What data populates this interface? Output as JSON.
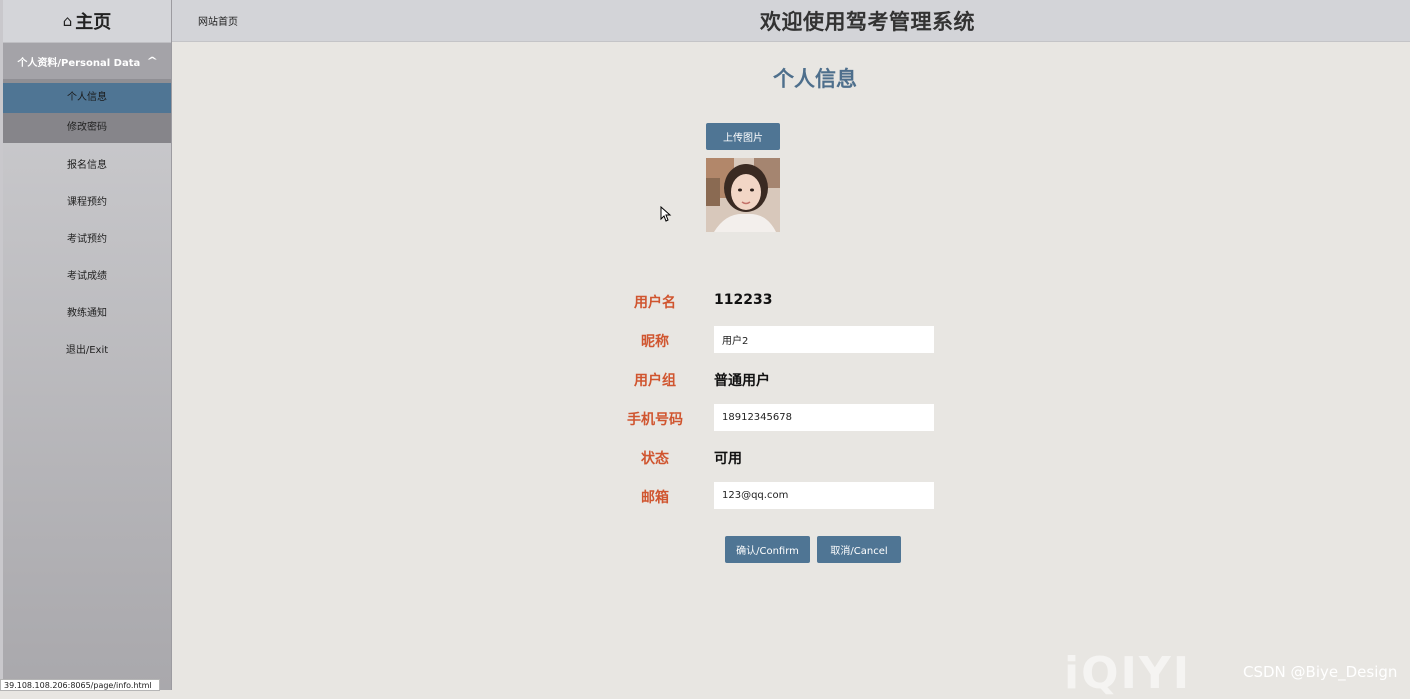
{
  "sidebar": {
    "home_label": "主页",
    "group_label": "个人资料/Personal Data",
    "sub_items": [
      {
        "label": "个人信息"
      },
      {
        "label": "修改密码"
      }
    ],
    "items": [
      {
        "label": "报名信息"
      },
      {
        "label": "课程预约"
      },
      {
        "label": "考试预约"
      },
      {
        "label": "考试成绩"
      },
      {
        "label": "教练通知"
      },
      {
        "label": "退出/Exit"
      }
    ]
  },
  "header": {
    "breadcrumb": "网站首页",
    "site_title": "欢迎使用驾考管理系统"
  },
  "main": {
    "title": "个人信息",
    "upload_label": "上传图片",
    "fields": {
      "username": {
        "label": "用户名",
        "value": "112233"
      },
      "nickname": {
        "label": "昵称",
        "value": "用户2"
      },
      "group": {
        "label": "用户组",
        "value": "普通用户"
      },
      "phone": {
        "label": "手机号码",
        "value": "18912345678"
      },
      "status": {
        "label": "状态",
        "value": "可用"
      },
      "email": {
        "label": "邮箱",
        "value": "123@qq.com"
      }
    },
    "confirm_label": "确认/Confirm",
    "cancel_label": "取消/Cancel"
  },
  "statusbar": {
    "url": "39.108.108.206:8065/page/info.html"
  },
  "watermarks": {
    "iqiyi": "iQIYI",
    "csdn": "CSDN @Biye_Design"
  },
  "colors": {
    "accent": "#4f7594",
    "label": "#d0552f",
    "title": "#4e6f8c"
  }
}
